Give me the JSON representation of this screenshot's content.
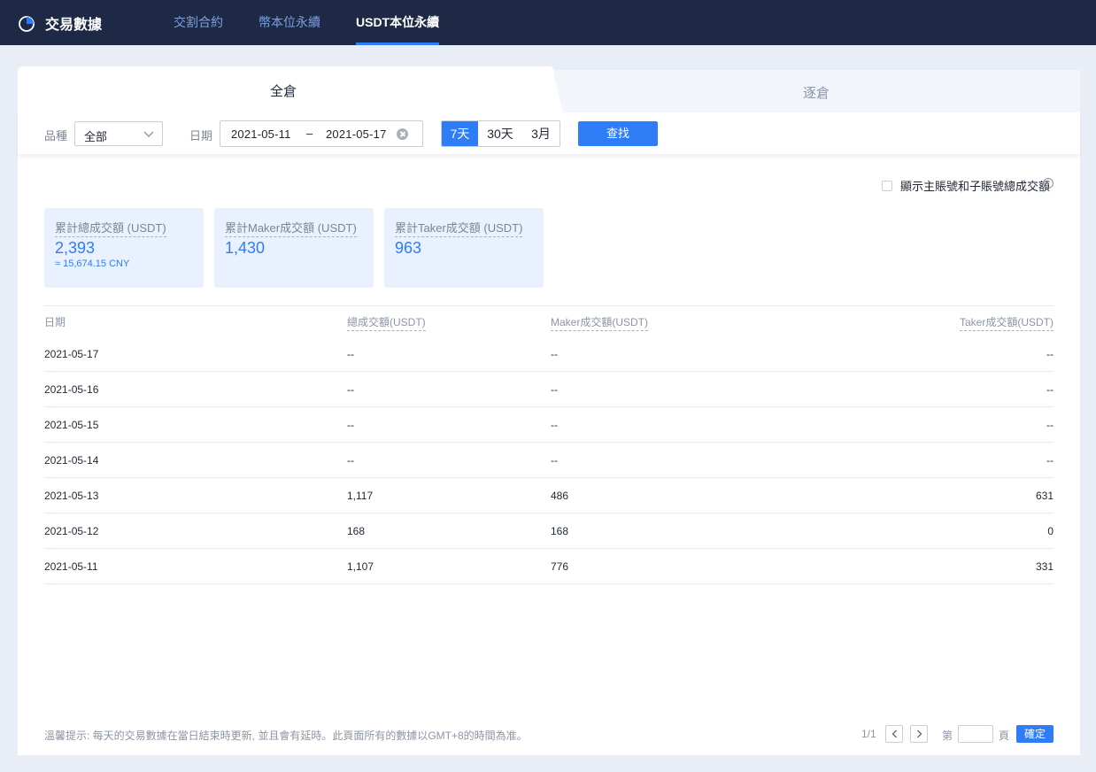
{
  "header": {
    "title": "交易數據",
    "nav": [
      "交割合約",
      "幣本位永續",
      "USDT本位永續"
    ],
    "active_nav": "USDT本位永續"
  },
  "tabs": {
    "active": "全倉",
    "inactive": "逐倉"
  },
  "filters": {
    "product_label": "品種",
    "product_value": "全部",
    "date_label": "日期",
    "date_start": "2021-05-11",
    "date_separator": "–",
    "date_end": "2021-05-17",
    "ranges": [
      "7天",
      "30天",
      "3月"
    ],
    "active_range": "7天",
    "search_label": "查找"
  },
  "toggle": {
    "label": "顯示主賬號和子賬號總成交額",
    "checked": false
  },
  "cards": [
    {
      "label": "累計總成交額 (USDT)",
      "value": "2,393",
      "sub": "≈ 15,674.15 CNY"
    },
    {
      "label": "累計Maker成交額 (USDT)",
      "value": "1,430"
    },
    {
      "label": "累計Taker成交額 (USDT)",
      "value": "963"
    }
  ],
  "table": {
    "columns": [
      "日期",
      "總成交額(USDT)",
      "Maker成交額(USDT)",
      "Taker成交額(USDT)"
    ],
    "rows": [
      [
        "2021-05-17",
        "--",
        "--",
        "--"
      ],
      [
        "2021-05-16",
        "--",
        "--",
        "--"
      ],
      [
        "2021-05-15",
        "--",
        "--",
        "--"
      ],
      [
        "2021-05-14",
        "--",
        "--",
        "--"
      ],
      [
        "2021-05-13",
        "1,117",
        "486",
        "631"
      ],
      [
        "2021-05-12",
        "168",
        "168",
        "0"
      ],
      [
        "2021-05-11",
        "1,107",
        "776",
        "331"
      ]
    ]
  },
  "footer": {
    "note": "溫馨提示: 每天的交易數據在當日結束時更新, 並且會有延時。此頁面所有的數據以GMT+8的時間為准。",
    "page_indicator": "1/1",
    "page_prefix": "第",
    "page_suffix": "頁",
    "confirm_label": "確定"
  },
  "colors": {
    "nav_bg": "#1e2a45",
    "accent": "#2f7df6",
    "card_bg": "#e8f1fd"
  }
}
